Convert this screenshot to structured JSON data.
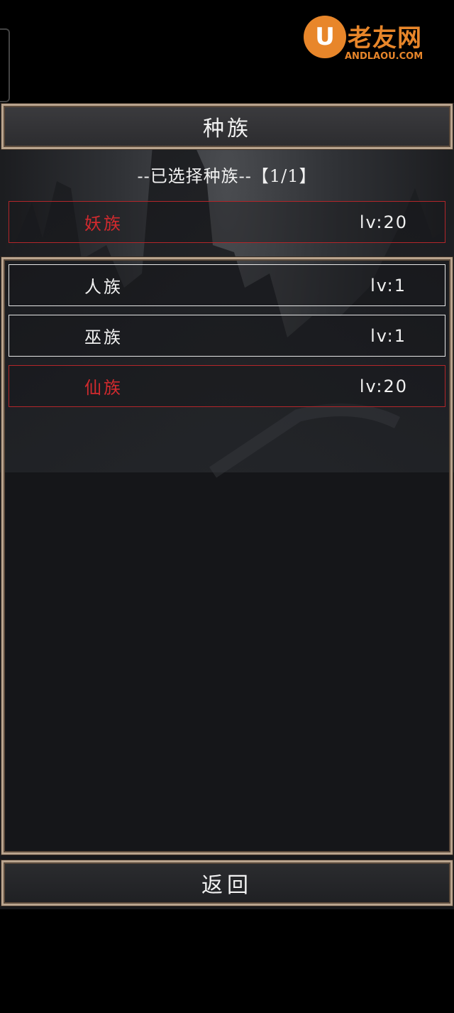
{
  "watermark": {
    "badge": "U",
    "title": "老友网",
    "subtitle": "ANDLAOU.COM"
  },
  "header": {
    "title": "种族"
  },
  "selection": {
    "label": "--已选择种族--【1/1】"
  },
  "selected_race": {
    "name": "妖族",
    "level": "lv:20",
    "color": "#d22a2e"
  },
  "races": [
    {
      "name": "人族",
      "level": "lv:1",
      "state": "normal"
    },
    {
      "name": "巫族",
      "level": "lv:1",
      "state": "normal"
    },
    {
      "name": "仙族",
      "level": "lv:20",
      "state": "highlighted"
    }
  ],
  "footer": {
    "back_label": "返回"
  },
  "colors": {
    "frame": "#b9a48e",
    "highlight": "#d22a2e",
    "brand": "#e8862a"
  }
}
